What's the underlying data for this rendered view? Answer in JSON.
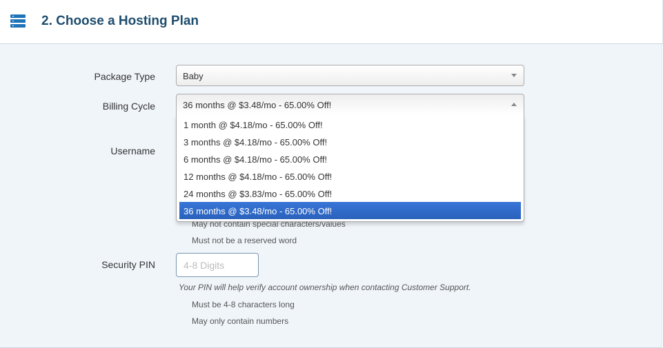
{
  "header": {
    "title": "2. Choose a Hosting Plan",
    "icon": "server-icon"
  },
  "form": {
    "package_type": {
      "label": "Package Type",
      "value": "Baby"
    },
    "billing_cycle": {
      "label": "Billing Cycle",
      "value": "36 months @ $3.48/mo - 65.00% Off!",
      "options": [
        "1 month @ $4.18/mo - 65.00% Off!",
        "3 months @ $4.18/mo - 65.00% Off!",
        "6 months @ $4.18/mo - 65.00% Off!",
        "12 months @ $4.18/mo - 65.00% Off!",
        "24 months @ $3.83/mo - 65.00% Off!",
        "36 months @ $3.48/mo - 65.00% Off!"
      ]
    },
    "username": {
      "label": "Username",
      "hints": [
        "May not contain special characters/values",
        "Must not be a reserved word"
      ]
    },
    "pin": {
      "label": "Security PIN",
      "placeholder": "4-8 Digits",
      "note": "Your PIN will help verify account ownership when contacting Customer Support.",
      "hints": [
        "Must be 4-8 characters long",
        "May only contain numbers"
      ]
    }
  },
  "colors": {
    "accent": "#1f73b7",
    "selected": "#3875d7",
    "title": "#1e4d6e"
  }
}
